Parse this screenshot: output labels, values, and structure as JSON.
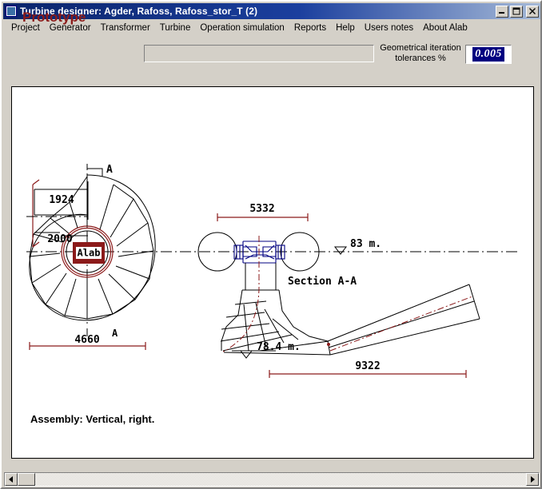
{
  "window": {
    "title": "Turbine designer: Agder, Rafoss, Rafoss_stor_T (2)",
    "icon": "app-window-icon",
    "buttons": {
      "minimize": "minimize-icon",
      "maximize": "maximize-icon",
      "close": "close-icon"
    }
  },
  "menu": {
    "items": [
      {
        "label": "Project"
      },
      {
        "label": "Generator"
      },
      {
        "label": "Transformer"
      },
      {
        "label": "Turbine"
      },
      {
        "label": "Operation simulation"
      },
      {
        "label": "Reports"
      },
      {
        "label": "Help"
      },
      {
        "label": "Users notes"
      },
      {
        "label": "About Alab"
      }
    ]
  },
  "header": {
    "prototype_label": "Prototype",
    "name_field_value": "",
    "name_field_placeholder": "",
    "tolerance_label": "Geometrical iteration tolerances %",
    "tolerance_value": "0.005"
  },
  "drawing": {
    "logo_text": "Alab",
    "section_marker": "A",
    "section_title": "Section A-A",
    "dimensions": {
      "spiral_height_upper": "1924",
      "spiral_height_lower": "2000",
      "spiral_diameter": "4660",
      "section_width": "5332",
      "draft_tube_length": "9322"
    },
    "levels": {
      "upper_water": "83 m.",
      "lower_water": "78.4 m."
    },
    "assembly_text": "Assembly: Vertical, right."
  },
  "scrollbar": {
    "left_arrow": "scroll-left-icon",
    "right_arrow": "scroll-right-icon",
    "thumb": "scroll-thumb"
  },
  "colors": {
    "title_bar": "#0a246a",
    "face": "#d4d0c8",
    "accent_red": "#8b1a1a",
    "accent_navy": "#000080",
    "canvas": "#ffffff"
  }
}
